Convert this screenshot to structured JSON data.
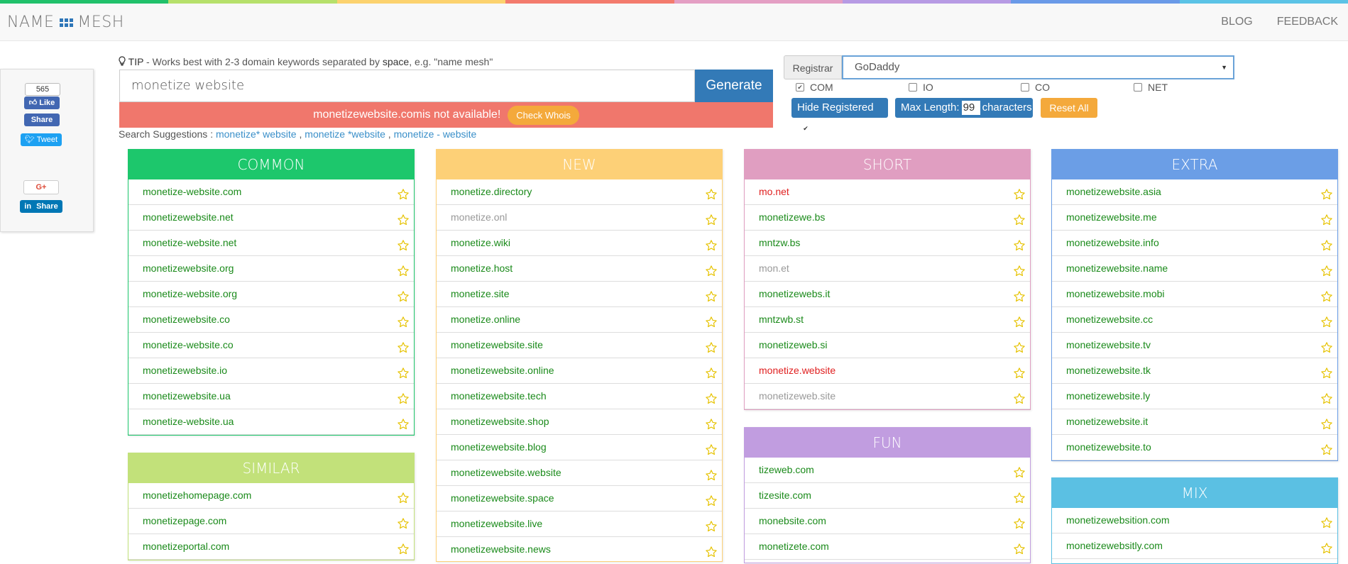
{
  "stripe_colors": [
    "#21c16b",
    "#b6e06b",
    "#fcd26e",
    "#f37b6d",
    "#e49fc4",
    "#b79be4",
    "#6a9ae8",
    "#5bc3e6"
  ],
  "header": {
    "logo_left": "NAME",
    "logo_right": "MESH",
    "nav": [
      "BLOG",
      "FEEDBACK"
    ]
  },
  "social": {
    "fb_count": "565",
    "fb_like": "Like",
    "fb_share": "Share",
    "tweet": "Tweet",
    "gplus": "G+",
    "li_share": "Share"
  },
  "tip": {
    "label": "TIP",
    "text1": " - Works best with 2-3 domain keywords separated by ",
    "bold": "space",
    "text2": ", e.g. \"name mesh\""
  },
  "search": {
    "value": "monetize website",
    "button": "Generate"
  },
  "alert": {
    "domain": "monetizewebsite.com",
    "text": " is not available!",
    "button": "Check Whois"
  },
  "suggestions": {
    "label": "Search Suggestions : ",
    "items": [
      "monetize* website",
      "monetize *website",
      "monetize - website"
    ],
    "sep": " , "
  },
  "registrar": {
    "label": "Registrar",
    "selected": "GoDaddy"
  },
  "tlds": [
    {
      "label": "COM",
      "checked": true
    },
    {
      "label": "IO",
      "checked": false
    },
    {
      "label": "CO",
      "checked": false
    },
    {
      "label": "NET",
      "checked": false
    }
  ],
  "options": {
    "hide_registered": "Hide Registered",
    "max_length_label": "Max Length:",
    "max_length_value": "99",
    "max_length_unit": "characters",
    "reset": "Reset All"
  },
  "columns": {
    "common": {
      "title": "COMMON",
      "color": "#1dc76c",
      "items": [
        {
          "d": "monetize-website.com",
          "s": "g"
        },
        {
          "d": "monetizewebsite.net",
          "s": "g"
        },
        {
          "d": "monetize-website.net",
          "s": "g"
        },
        {
          "d": "monetizewebsite.org",
          "s": "g"
        },
        {
          "d": "monetize-website.org",
          "s": "g"
        },
        {
          "d": "monetizewebsite.co",
          "s": "g"
        },
        {
          "d": "monetize-website.co",
          "s": "g"
        },
        {
          "d": "monetizewebsite.io",
          "s": "g"
        },
        {
          "d": "monetizewebsite.ua",
          "s": "g"
        },
        {
          "d": "monetize-website.ua",
          "s": "g"
        }
      ]
    },
    "similar": {
      "title": "SIMILAR",
      "color": "#c2e17a",
      "items": [
        {
          "d": "monetizehomepage.com",
          "s": "g"
        },
        {
          "d": "monetizepage.com",
          "s": "g"
        },
        {
          "d": "monetizeportal.com",
          "s": "g"
        }
      ]
    },
    "new": {
      "title": "NEW",
      "color": "#fdd077",
      "items": [
        {
          "d": "monetize.directory",
          "s": "g"
        },
        {
          "d": "monetize.onl",
          "s": "n"
        },
        {
          "d": "monetize.wiki",
          "s": "g"
        },
        {
          "d": "monetize.host",
          "s": "g"
        },
        {
          "d": "monetize.site",
          "s": "g"
        },
        {
          "d": "monetize.online",
          "s": "g"
        },
        {
          "d": "monetizewebsite.site",
          "s": "g"
        },
        {
          "d": "monetizewebsite.online",
          "s": "g"
        },
        {
          "d": "monetizewebsite.tech",
          "s": "g"
        },
        {
          "d": "monetizewebsite.shop",
          "s": "g"
        },
        {
          "d": "monetizewebsite.blog",
          "s": "g"
        },
        {
          "d": "monetizewebsite.website",
          "s": "g"
        },
        {
          "d": "monetizewebsite.space",
          "s": "g"
        },
        {
          "d": "monetizewebsite.live",
          "s": "g"
        },
        {
          "d": "monetizewebsite.news",
          "s": "g"
        }
      ]
    },
    "short": {
      "title": "SHORT",
      "color": "#e09ec1",
      "items": [
        {
          "d": "mo.net",
          "s": "r"
        },
        {
          "d": "monetizewe.bs",
          "s": "g"
        },
        {
          "d": "mntzw.bs",
          "s": "g"
        },
        {
          "d": "mon.et",
          "s": "n"
        },
        {
          "d": "monetizewebs.it",
          "s": "g"
        },
        {
          "d": "mntzwb.st",
          "s": "g"
        },
        {
          "d": "monetizeweb.si",
          "s": "g"
        },
        {
          "d": "monetize.website",
          "s": "r"
        },
        {
          "d": "monetizeweb.site",
          "s": "n"
        }
      ]
    },
    "fun": {
      "title": "FUN",
      "color": "#c19de0",
      "items": [
        {
          "d": "tizeweb.com",
          "s": "g"
        },
        {
          "d": "tizesite.com",
          "s": "g"
        },
        {
          "d": "monebsite.com",
          "s": "g"
        },
        {
          "d": "monetizete.com",
          "s": "g"
        }
      ]
    },
    "extra": {
      "title": "EXTRA",
      "color": "#6b9ee6",
      "items": [
        {
          "d": "monetizewebsite.asia",
          "s": "g"
        },
        {
          "d": "monetizewebsite.me",
          "s": "g"
        },
        {
          "d": "monetizewebsite.info",
          "s": "g"
        },
        {
          "d": "monetizewebsite.name",
          "s": "g"
        },
        {
          "d": "monetizewebsite.mobi",
          "s": "g"
        },
        {
          "d": "monetizewebsite.cc",
          "s": "g"
        },
        {
          "d": "monetizewebsite.tv",
          "s": "g"
        },
        {
          "d": "monetizewebsite.tk",
          "s": "g"
        },
        {
          "d": "monetizewebsite.ly",
          "s": "g"
        },
        {
          "d": "monetizewebsite.it",
          "s": "g"
        },
        {
          "d": "monetizewebsite.to",
          "s": "g"
        }
      ]
    },
    "mix": {
      "title": "MIX",
      "color": "#5bc0e3",
      "items": [
        {
          "d": "monetizewebsition.com",
          "s": "g"
        },
        {
          "d": "monetizewebsitly.com",
          "s": "g"
        }
      ]
    }
  }
}
